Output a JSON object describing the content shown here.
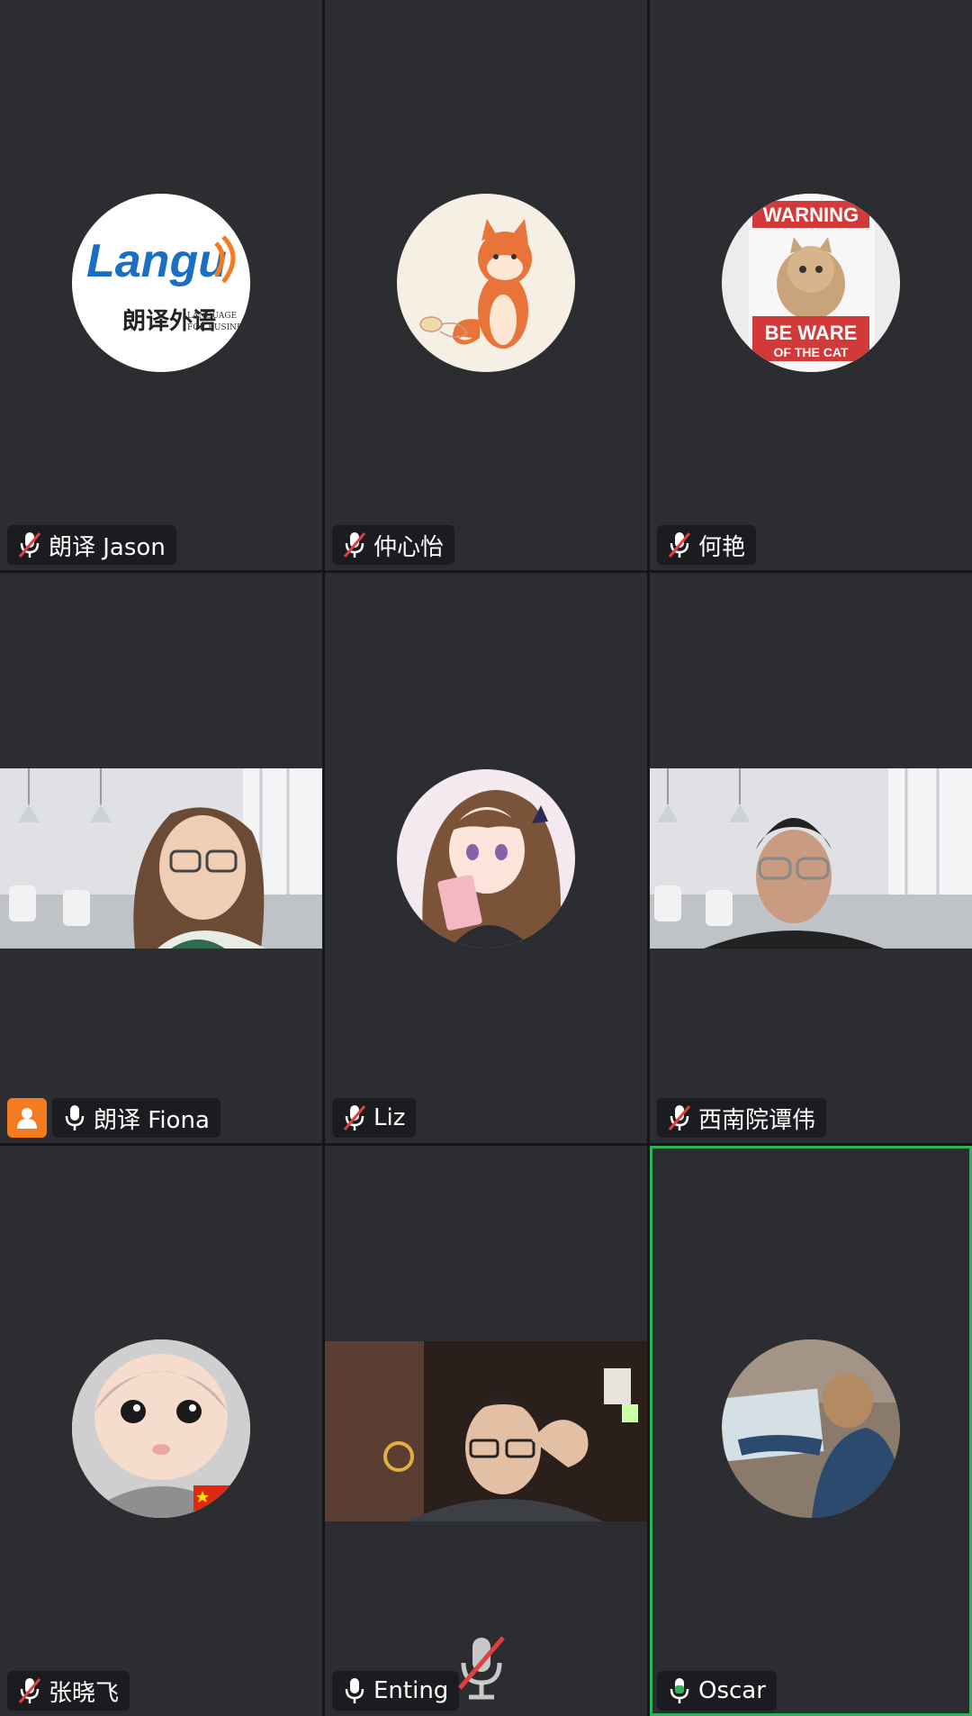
{
  "participants": [
    {
      "name": "朗译 Jason",
      "mic": "muted",
      "avatar": "langu-logo",
      "logo_text": "Langu",
      "logo_sub_cn": "朗译外语",
      "logo_sub_en1": "LANGUAGE",
      "logo_sub_en2": "FOR BUSINESS"
    },
    {
      "name": "仲心怡",
      "mic": "muted",
      "avatar": "fox-cartoon"
    },
    {
      "name": "何艳",
      "mic": "muted",
      "avatar": "warning-cat-poster",
      "poster_top": "WARNING",
      "poster_mid": "BE WARE",
      "poster_bottom": "OF THE CAT"
    },
    {
      "name": "朗译 Fiona",
      "mic": "on",
      "host": true,
      "video": "woman-office"
    },
    {
      "name": "Liz",
      "mic": "muted",
      "avatar": "anime-girl"
    },
    {
      "name": "西南院谭伟",
      "mic": "muted",
      "video": "man-office"
    },
    {
      "name": "张晓飞",
      "mic": "muted",
      "avatar": "baby-photo"
    },
    {
      "name": "Enting",
      "mic": "on",
      "video": "man-dark-room"
    },
    {
      "name": "Oscar",
      "mic": "on-speaking",
      "active": true,
      "avatar": "child-with-map"
    }
  ],
  "colors": {
    "tile_bg": "#2b2d31",
    "gutter": "#151618",
    "tag_bg": "#1b1c1f",
    "muted_slash": "#e04040",
    "speaking_green": "#2fb35a",
    "host_orange": "#f47b20",
    "logo_blue": "#1b6fc2",
    "logo_orange": "#f47b20",
    "poster_red": "#d23a3a"
  }
}
